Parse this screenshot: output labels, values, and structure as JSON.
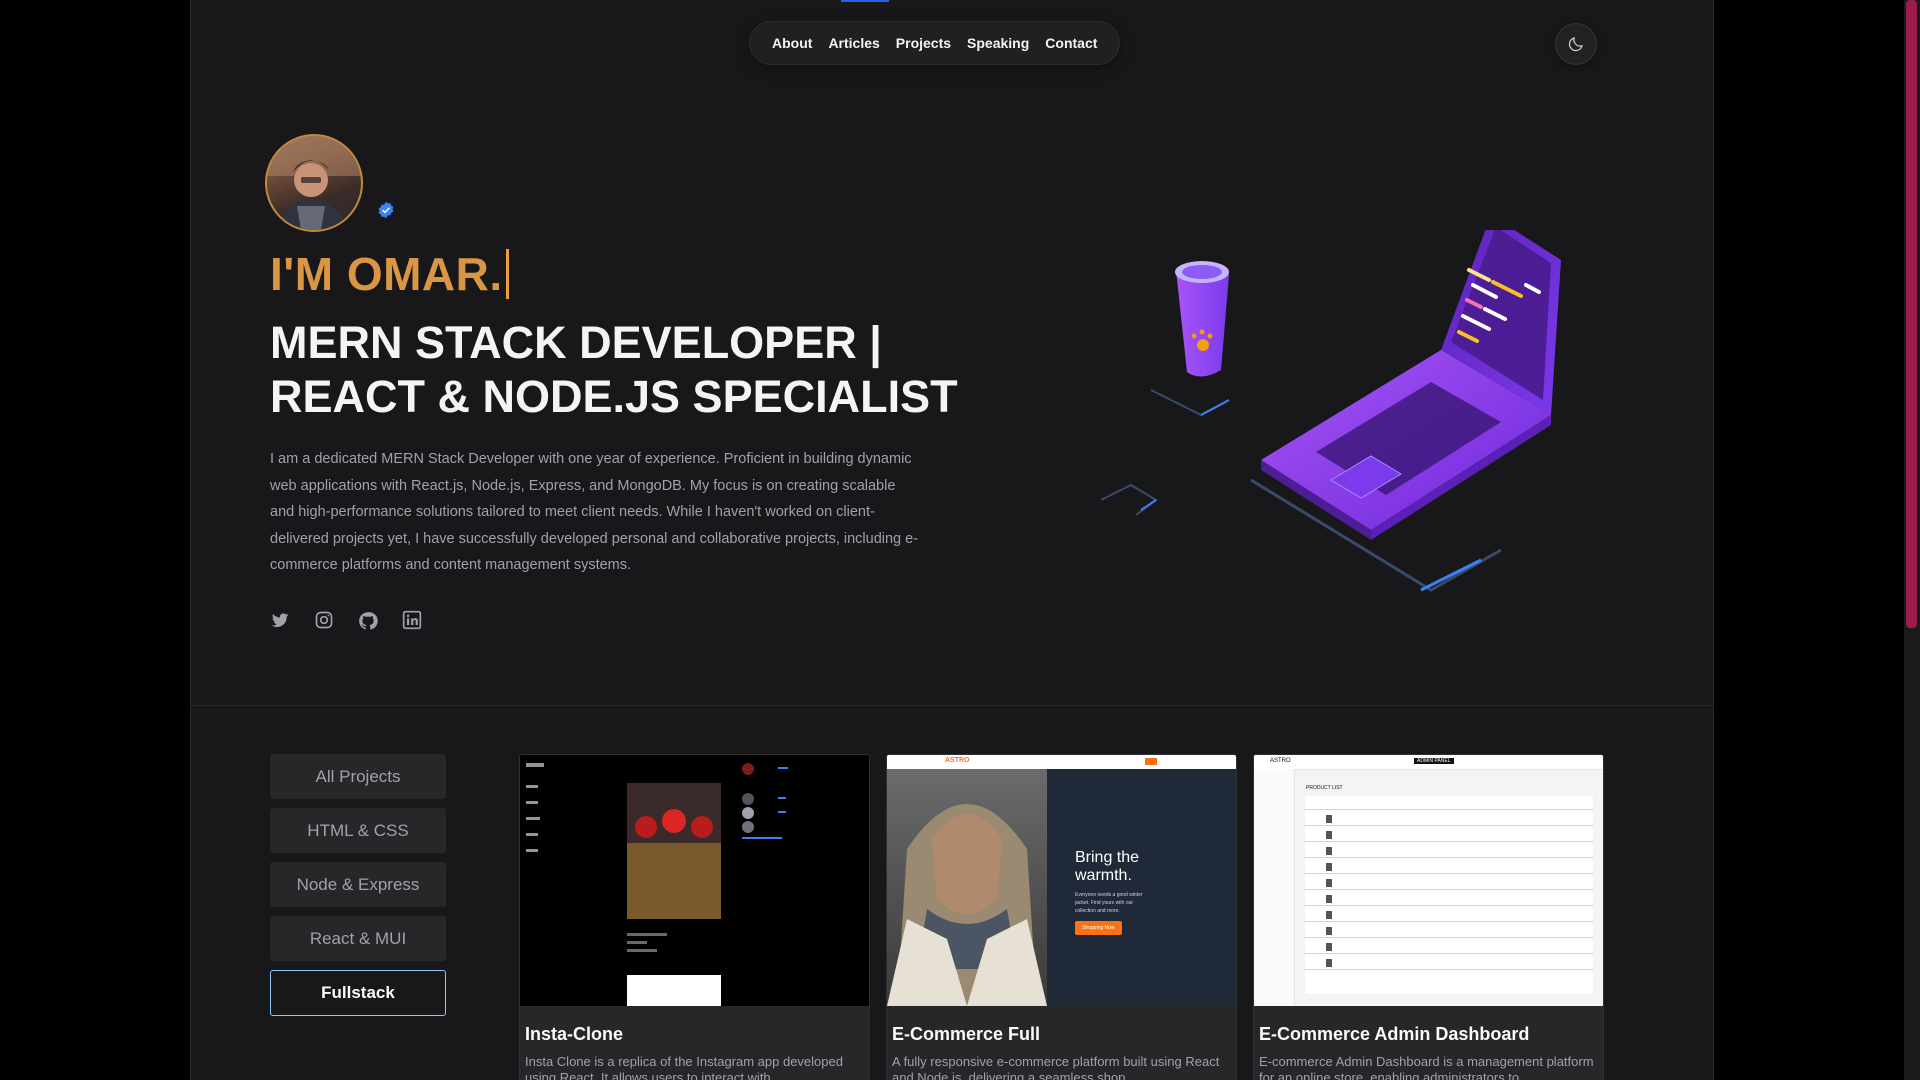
{
  "nav": {
    "items": [
      {
        "label": "About"
      },
      {
        "label": "Articles"
      },
      {
        "label": "Projects"
      },
      {
        "label": "Speaking"
      },
      {
        "label": "Contact"
      }
    ]
  },
  "theme_toggle": {
    "icon": "moon-icon"
  },
  "hero": {
    "greeting": "I'M OMAR.",
    "headline_line1": "MERN STACK DEVELOPER |",
    "headline_line2": "REACT & NODE.JS SPECIALIST",
    "bio": "I am a dedicated MERN Stack Developer with one year of experience. Proficient in building dynamic web applications with React.js, Node.js, Express, and MongoDB. My focus is on creating scalable and high-performance solutions tailored to meet client needs. While I haven't worked on client-delivered projects yet, I have successfully developed personal and collaborative projects, including e-commerce platforms and content management systems.",
    "socials": [
      "twitter-icon",
      "instagram-icon",
      "github-icon",
      "linkedin-icon"
    ]
  },
  "filters": {
    "items": [
      {
        "label": "All Projects",
        "active": false
      },
      {
        "label": "HTML & CSS",
        "active": false
      },
      {
        "label": "Node & Express",
        "active": false
      },
      {
        "label": "React & MUI",
        "active": false
      },
      {
        "label": "Fullstack",
        "active": true
      }
    ]
  },
  "projects": [
    {
      "title": "Insta-Clone",
      "desc": "Insta Clone is a replica of the Instagram app developed using React. It allows users to interact with"
    },
    {
      "title": "E-Commerce Full",
      "desc": "A fully responsive e-commerce platform built using React and Node.js, delivering a seamless shop",
      "thumb_brand": "ASTRO",
      "thumb_heading": "Bring the warmth.",
      "thumb_text": "Everyone needs a good winter jacket. Find yours with our collection and more.",
      "thumb_button": "Shopping Now"
    },
    {
      "title": "E-Commerce Admin Dashboard",
      "desc": "E-commerce Admin Dashboard is a management platform for an online store, enabling administrators to",
      "thumb_brand": "ASTRO",
      "thumb_badge": "ADMIN PANEL",
      "thumb_list_title": "PRODUCT LIST"
    }
  ],
  "colors": {
    "accent": "#d99644",
    "active_border": "#93c5fd",
    "background": "#18181b"
  }
}
